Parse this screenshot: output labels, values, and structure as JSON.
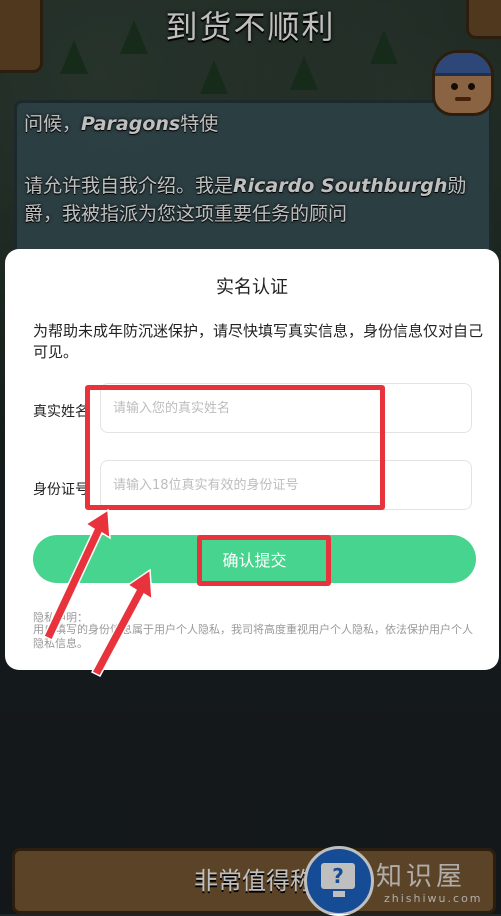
{
  "game": {
    "title": "到货不顺利",
    "greeting_prefix": "问候，",
    "greeting_name": "Paragons",
    "greeting_suffix": "特使",
    "intro_prefix": "请允许我自我介绍。我是",
    "intro_name": "Ricardo Southburgh",
    "intro_suffix": "勋爵，我被指派为您这项重要任务的顾问",
    "bottom_button_label": "非常值得称"
  },
  "modal": {
    "title": "实名认证",
    "description": "为帮助未成年防沉迷保护，请尽快填写真实信息，身份信息仅对自己可见。",
    "name_field": {
      "label": "真实姓名",
      "placeholder": "请输入您的真实姓名",
      "value": ""
    },
    "id_field": {
      "label": "身份证号",
      "placeholder": "请输入18位真实有效的身份证号",
      "value": ""
    },
    "submit_label": "确认提交",
    "privacy_title": "隐私申明：",
    "privacy_body": "用户填写的身份信息属于用户个人隐私，我司将高度重视用户个人隐私，依法保护用户个人隐私信息。"
  },
  "watermark": {
    "icon_glyph": "?",
    "text": "知识屋",
    "sub": "zhishiwu.com"
  },
  "colors": {
    "accent_green": "#47d48e",
    "annotation_red": "#e8323c"
  },
  "icons": [
    "avatar-portrait",
    "question-monitor-icon"
  ]
}
